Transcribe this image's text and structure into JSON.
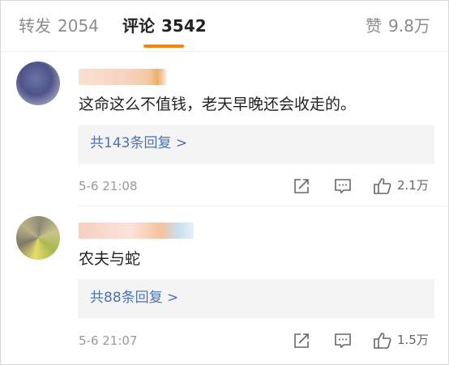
{
  "tabs": [
    {
      "label": "转发",
      "count": "2054"
    },
    {
      "label": "评论",
      "count": "3542"
    },
    {
      "label": "赞",
      "count": "9.8万"
    }
  ],
  "comments": [
    {
      "text": "这命这么不值钱，老天早晚还会收走的。",
      "replies": "共143条回复 >",
      "time": "5-6 21:08",
      "likes": "2.1万"
    },
    {
      "text": "农夫与蛇",
      "replies": "共88条回复 >",
      "time": "5-6 21:07",
      "likes": "1.5万"
    }
  ],
  "colors": {
    "accent": "#ff8200",
    "link": "#4b74b3"
  },
  "icons": [
    "share-icon",
    "comment-icon",
    "like-icon"
  ]
}
